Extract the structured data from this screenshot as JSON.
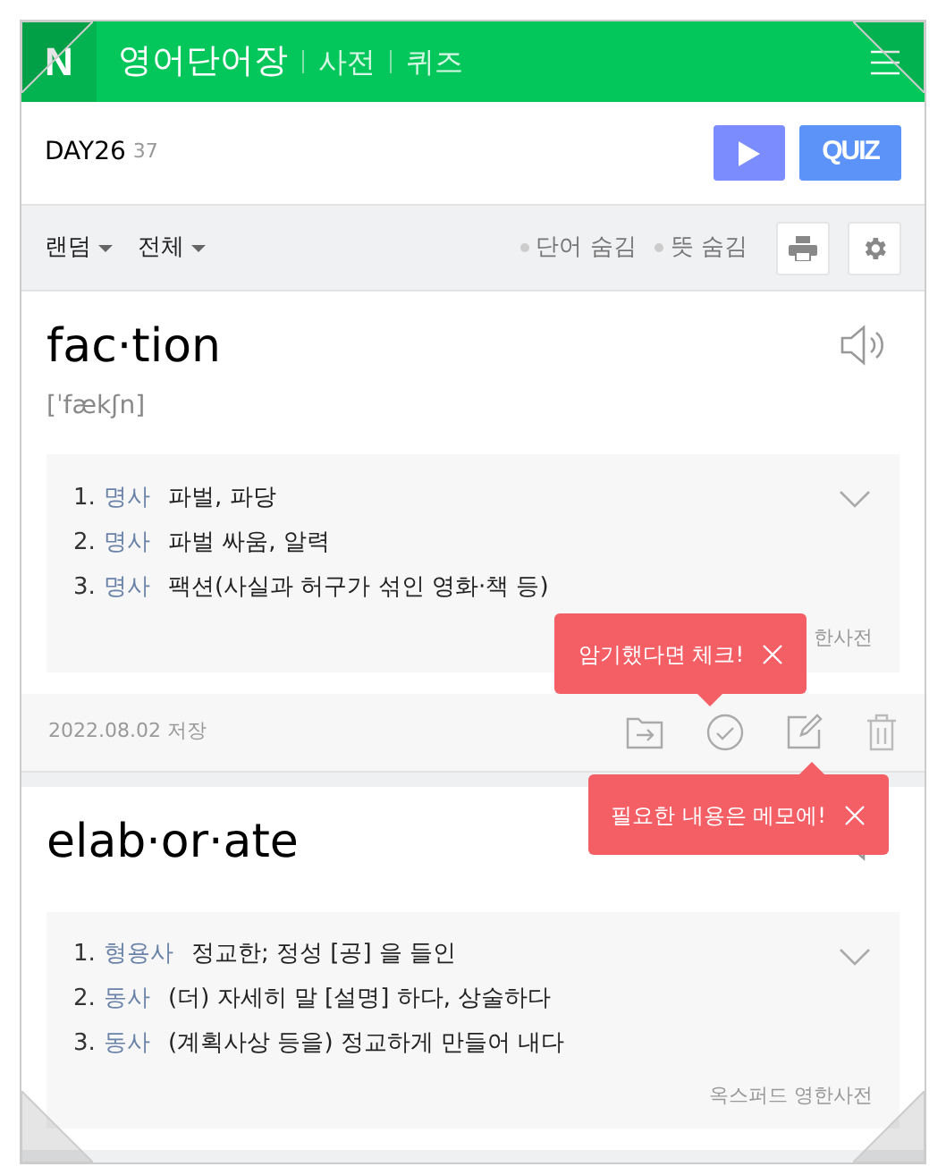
{
  "header": {
    "logo": "N",
    "title": "영어단어장",
    "links": [
      "사전",
      "퀴즈"
    ]
  },
  "day": {
    "label": "DAY26",
    "count": "37",
    "quiz_button": "QUIZ"
  },
  "toolbar": {
    "dropdowns": [
      "랜덤",
      "전체"
    ],
    "toggles": [
      {
        "label": "단어 숨김",
        "on": false
      },
      {
        "label": "뜻 숨김",
        "on": false
      }
    ]
  },
  "words": [
    {
      "word": "fac·tion",
      "pron": "[ˈfækʃn]",
      "senses": [
        {
          "num": "1.",
          "pos": "명사",
          "text": "파벌, 파당"
        },
        {
          "num": "2.",
          "pos": "명사",
          "text": "파벌 싸움, 알력"
        },
        {
          "num": "3.",
          "pos": "명사",
          "text": "팩션(사실과 허구가 섞인 영화·책 등)"
        }
      ],
      "source": "한사전",
      "date": "2022.08.02 저장"
    },
    {
      "word": "elab·or·ate",
      "senses": [
        {
          "num": "1.",
          "pos": "형용사",
          "text": "정교한; 정성 [공] 을 들인"
        },
        {
          "num": "2.",
          "pos": "동사",
          "text": "(더) 자세히 말 [설명] 하다, 상술하다"
        },
        {
          "num": "3.",
          "pos": "동사",
          "text": "(계획사상 등을) 정교하게 만들어 내다"
        }
      ],
      "source": "옥스퍼드 영한사전"
    }
  ],
  "tooltips": [
    "암기했다면 체크!",
    "필요한 내용은 메모에!"
  ]
}
